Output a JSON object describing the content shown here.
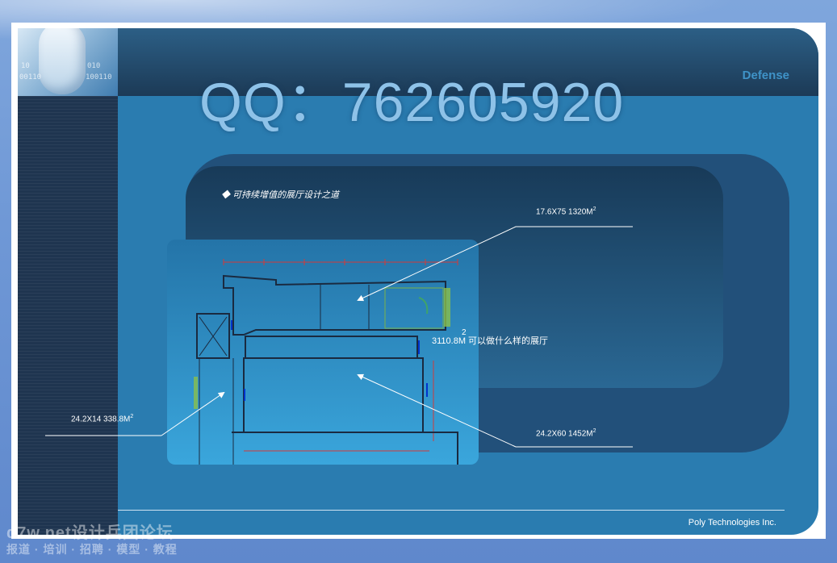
{
  "header": {
    "qq_title": "QQ：762605920",
    "brand": "Defense"
  },
  "logo": {
    "binary_lines": [
      "10",
      "010",
      "00110",
      "100110"
    ]
  },
  "content": {
    "heading": "◆ 可持续增值的展厅设计之道",
    "label_top": "17.6X75  1320M",
    "label_top_sup": "2",
    "label_mid_sup": "2",
    "label_mid": "3110.8M 可以做什么样的展厅",
    "label_left": "24.2X14  338.8M",
    "label_left_sup": "2",
    "label_bottom": "24.2X60  1452M",
    "label_bottom_sup": "2"
  },
  "footer": {
    "company": "Poly Technologies Inc."
  },
  "watermark": {
    "line1": "d7w.net设计兵团论坛",
    "line2": "报道 · 培训 · 招聘 · 模型 · 教程"
  },
  "colors": {
    "frame": "#2a7cb0",
    "sidebar": "#1f3550",
    "title": "#8ec2e8",
    "brand": "#3f93c8",
    "plan_lines": "#1a2a40",
    "plan_dims": "#d23a3a"
  }
}
